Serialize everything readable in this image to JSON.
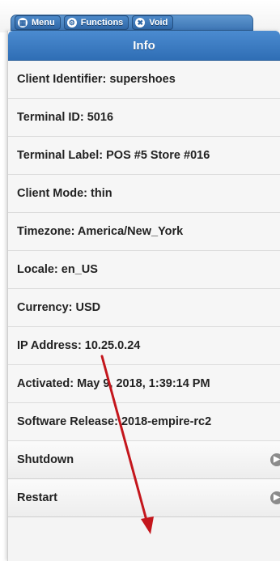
{
  "tabs": [
    {
      "label": "Menu",
      "icon": "grid-icon"
    },
    {
      "label": "Functions",
      "icon": "gear-icon"
    },
    {
      "label": "Void",
      "icon": "close-icon"
    }
  ],
  "panel": {
    "title": "Info",
    "info_rows": [
      "Client Identifier: supershoes",
      "Terminal ID: 5016",
      "Terminal Label: POS #5 Store #016",
      "Client Mode: thin",
      "Timezone: America/New_York",
      "Locale: en_US",
      "Currency: USD",
      "IP Address: 10.25.0.24",
      "Activated: May 9, 2018, 1:39:14 PM",
      "Software Release: 2018-empire-rc2"
    ],
    "actions": [
      "Shutdown",
      "Restart"
    ]
  },
  "colors": {
    "header": "#2f6eb5",
    "annotation_arrow": "#c4161c"
  }
}
